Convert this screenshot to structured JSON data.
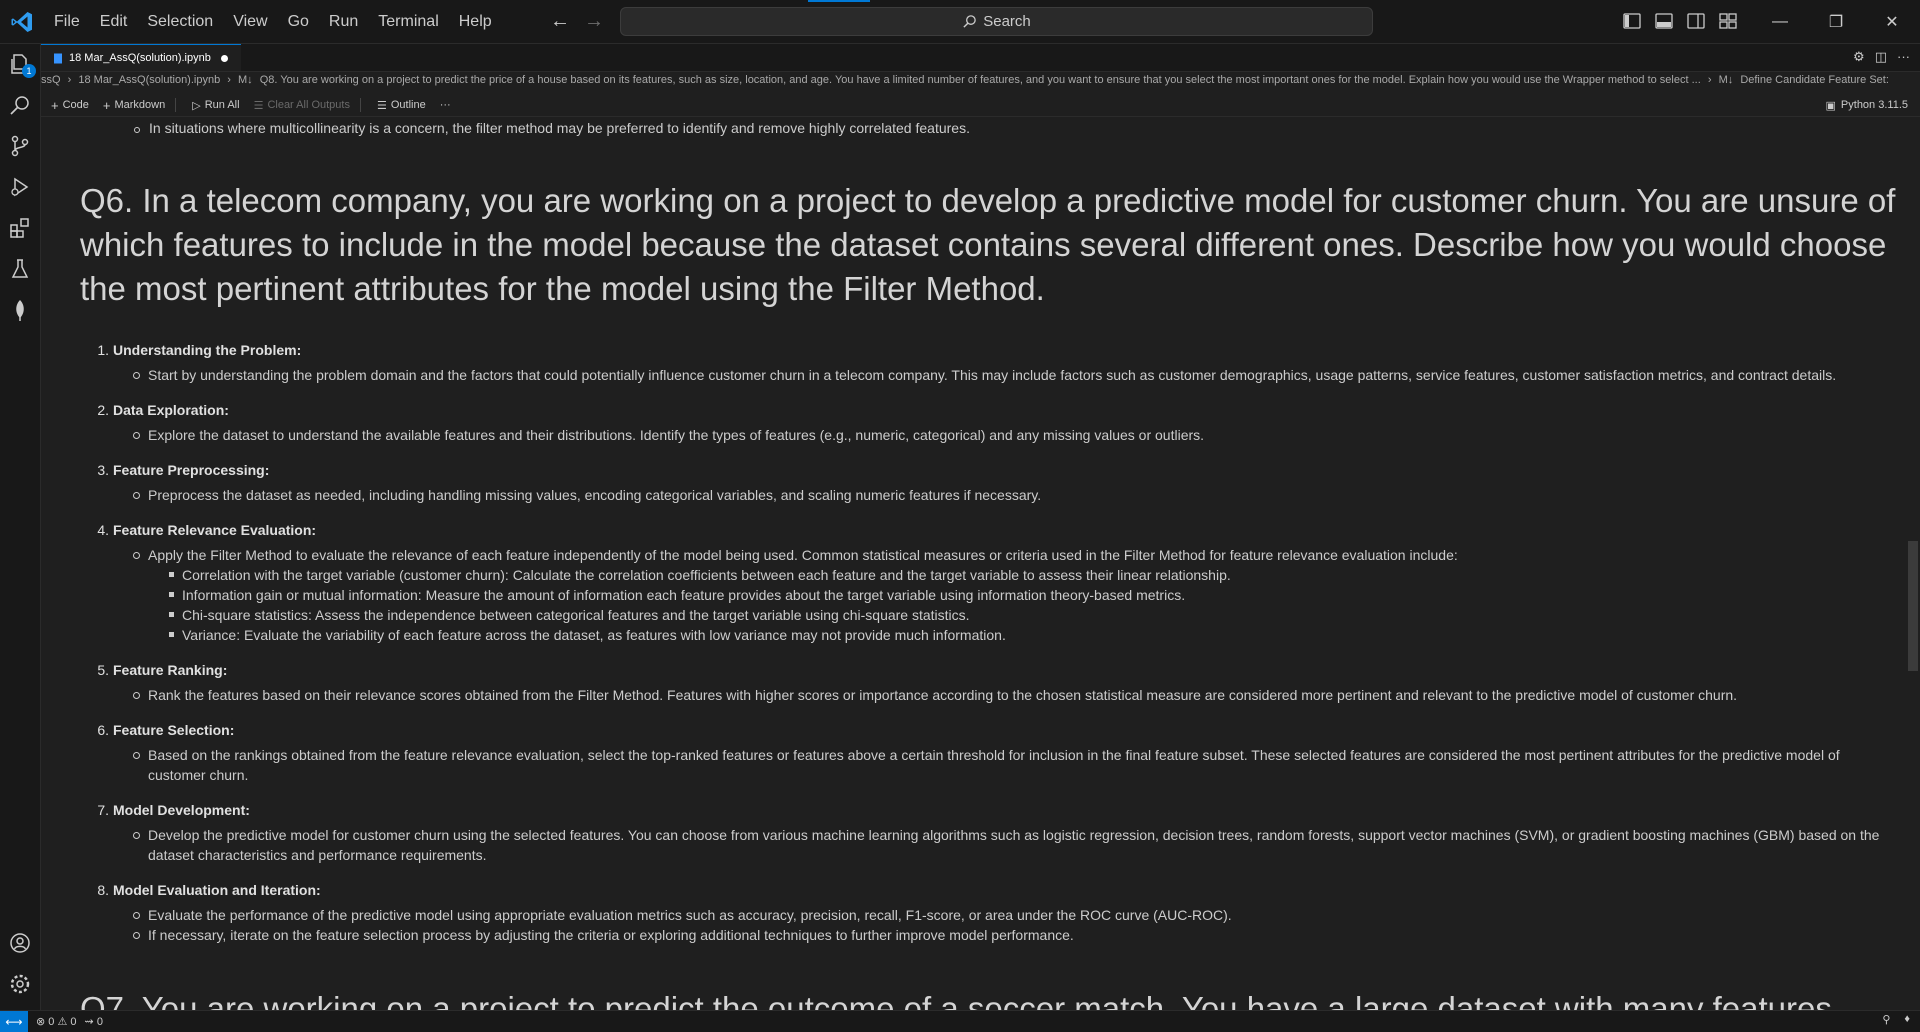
{
  "menu": [
    "File",
    "Edit",
    "Selection",
    "View",
    "Go",
    "Run",
    "Terminal",
    "Help"
  ],
  "search": {
    "label": "Search"
  },
  "activity": {
    "explorer_badge": "1"
  },
  "tab": {
    "title": "18 Mar_AssQ(solution).ipynb"
  },
  "breadcrumb": {
    "root": "ssQ",
    "file": "18 Mar_AssQ(solution).ipynb",
    "md_marker": "M↓",
    "cell": "Q8. You are working on a project to predict the price of a house based on its features, such as size, location, and age. You have a limited number of features, and you want to ensure that you select the most important ones for the model. Explain how you would use the Wrapper method to select ...",
    "section_marker": "M↓",
    "section": "Define Candidate Feature Set:"
  },
  "toolbar": {
    "code": "Code",
    "markdown": "Markdown",
    "run_all": "Run All",
    "clear_outputs": "Clear All Outputs",
    "outline": "Outline",
    "more": "···",
    "kernel": "Python 3.11.5"
  },
  "content": {
    "top_bullet": "In situations where multicollinearity is a concern, the filter method may be preferred to identify and remove highly correlated features.",
    "q6_heading": "Q6. In a telecom company, you are working on a project to develop a predictive model for customer churn. You are unsure of which features to include in the model because the dataset contains several different ones. Describe how you would choose the most pertinent attributes for the model using the Filter Method.",
    "steps": [
      {
        "num": "1.",
        "title": "Understanding the Problem:",
        "points": [
          "Start by understanding the problem domain and the factors that could potentially influence customer churn in a telecom company. This may include factors such as customer demographics, usage patterns, service features, customer satisfaction metrics, and contract details."
        ]
      },
      {
        "num": "2.",
        "title": "Data Exploration:",
        "points": [
          "Explore the dataset to understand the available features and their distributions. Identify the types of features (e.g., numeric, categorical) and any missing values or outliers."
        ]
      },
      {
        "num": "3.",
        "title": "Feature Preprocessing:",
        "points": [
          "Preprocess the dataset as needed, including handling missing values, encoding categorical variables, and scaling numeric features if necessary."
        ]
      },
      {
        "num": "4.",
        "title": "Feature Relevance Evaluation:",
        "points": [
          "Apply the Filter Method to evaluate the relevance of each feature independently of the model being used. Common statistical measures or criteria used in the Filter Method for feature relevance evaluation include:"
        ],
        "subpoints": [
          "Correlation with the target variable (customer churn): Calculate the correlation coefficients between each feature and the target variable to assess their linear relationship.",
          "Information gain or mutual information: Measure the amount of information each feature provides about the target variable using information theory-based metrics.",
          "Chi-square statistics: Assess the independence between categorical features and the target variable using chi-square statistics.",
          "Variance: Evaluate the variability of each feature across the dataset, as features with low variance may not provide much information."
        ]
      },
      {
        "num": "5.",
        "title": "Feature Ranking:",
        "points": [
          "Rank the features based on their relevance scores obtained from the Filter Method. Features with higher scores or importance according to the chosen statistical measure are considered more pertinent and relevant to the predictive model of customer churn."
        ]
      },
      {
        "num": "6.",
        "title": "Feature Selection:",
        "points": [
          "Based on the rankings obtained from the feature relevance evaluation, select the top-ranked features or features above a certain threshold for inclusion in the final feature subset. These selected features are considered the most pertinent attributes for the predictive model of customer churn."
        ]
      },
      {
        "num": "7.",
        "title": "Model Development:",
        "points": [
          "Develop the predictive model for customer churn using the selected features. You can choose from various machine learning algorithms such as logistic regression, decision trees, random forests, support vector machines (SVM), or gradient boosting machines (GBM) based on the dataset characteristics and performance requirements."
        ]
      },
      {
        "num": "8.",
        "title": "Model Evaluation and Iteration:",
        "points": [
          "Evaluate the performance of the predictive model using appropriate evaluation metrics such as accuracy, precision, recall, F1-score, or area under the ROC curve (AUC-ROC).",
          "If necessary, iterate on the feature selection process by adjusting the criteria or exploring additional techniques to further improve model performance."
        ]
      }
    ],
    "next_heading_partial": "Q7. You are working on a project to predict the outcome of a soccer match. You have a large dataset with many features"
  },
  "status": {
    "errors": "0",
    "warnings": "0",
    "ports": "0"
  }
}
